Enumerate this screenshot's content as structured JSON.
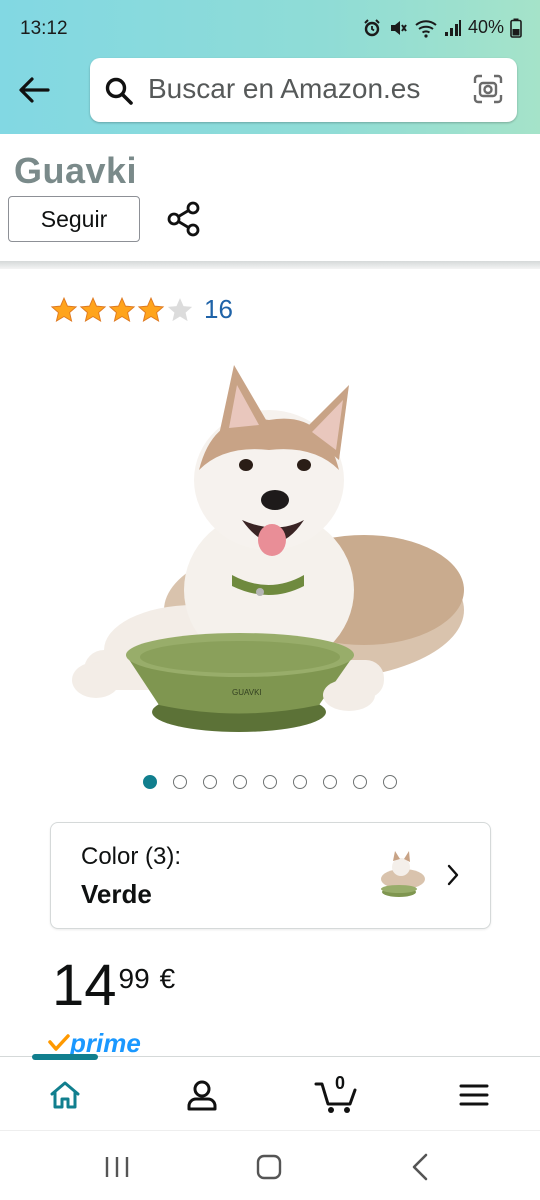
{
  "status_bar": {
    "time": "13:12",
    "battery": "40%",
    "icons": [
      "alarm-icon",
      "mute-icon",
      "wifi-icon",
      "signal-icon",
      "battery-icon"
    ]
  },
  "header": {
    "back_icon": "arrow-left-icon",
    "search_placeholder": "Buscar en Amazon.es",
    "camera_icon": "camera-scan-icon"
  },
  "brand": {
    "name": "Guavki",
    "follow_label": "Seguir",
    "share_icon": "share-icon"
  },
  "product": {
    "rating": 4,
    "rating_max": 5,
    "rating_count": "16",
    "image_alt": "dog-with-green-lick-bowl",
    "image_count": 9,
    "active_image_index": 0,
    "color_section": {
      "label": "Color (3):",
      "value": "Verde"
    },
    "price": {
      "whole": "14",
      "fraction": "99",
      "currency": "€"
    },
    "prime_label": "prime"
  },
  "bottom_nav": {
    "items": [
      {
        "name": "home",
        "icon": "home-icon",
        "active": true
      },
      {
        "name": "account",
        "icon": "user-icon",
        "active": false
      },
      {
        "name": "cart",
        "icon": "cart-icon",
        "active": false,
        "count": "0"
      },
      {
        "name": "menu",
        "icon": "menu-icon",
        "active": false
      }
    ]
  },
  "system_nav": [
    "recents-icon",
    "home-button-icon",
    "back-icon"
  ],
  "colors": {
    "header_gradient_start": "#82d8e3",
    "header_gradient_end": "#a5e3c9",
    "link_blue": "#1f63a8",
    "accent_teal": "#117f8e",
    "star_gold": "#ffa41c",
    "prime_blue": "#1a98ff"
  }
}
